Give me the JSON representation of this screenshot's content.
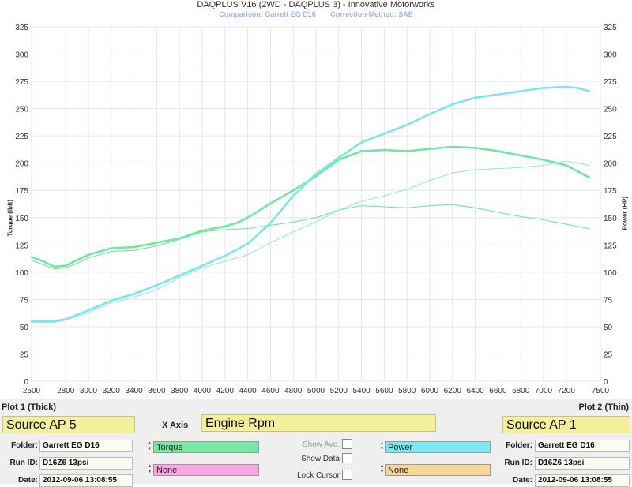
{
  "header": {
    "title": "DAQPLUS V16 (2WD - DAQPLUS 3) - Innovative Motorworks",
    "comparison": "Comparison: Garrett EG D16",
    "correction": "Correction-Method: SAE"
  },
  "chart_data": {
    "type": "line",
    "xlabel": "",
    "ylabel_left": "Torque (lbft)",
    "ylabel_right": "Power (HP)",
    "xlim": [
      2500,
      7500
    ],
    "ylim": [
      0,
      325
    ],
    "x_ticks": [
      2500,
      2800,
      3000,
      3200,
      3400,
      3600,
      3800,
      4000,
      4200,
      4400,
      4600,
      4800,
      5000,
      5200,
      5400,
      5600,
      5800,
      6000,
      6200,
      6400,
      6600,
      6800,
      7000,
      7200,
      7500
    ],
    "y_ticks": [
      0,
      25,
      50,
      75,
      100,
      125,
      150,
      175,
      200,
      225,
      250,
      275,
      300,
      325
    ],
    "grid": true,
    "series": [
      {
        "name": "Torque",
        "plot": "Plot 1 (Thick)",
        "color": "#6ee8a0",
        "width": 2.6,
        "x": [
          2500,
          2600,
          2700,
          2800,
          2900,
          3000,
          3200,
          3400,
          3600,
          3800,
          4000,
          4200,
          4300,
          4400,
          4600,
          4800,
          5000,
          5200,
          5400,
          5600,
          5800,
          6000,
          6200,
          6400,
          6600,
          6800,
          7000,
          7200,
          7400
        ],
        "values": [
          114,
          110,
          105,
          106,
          111,
          116,
          122,
          123,
          127,
          131,
          138,
          142,
          145,
          150,
          163,
          175,
          188,
          203,
          211,
          212,
          211,
          213,
          215,
          214,
          211,
          207,
          203,
          198,
          187
        ]
      },
      {
        "name": "Power",
        "plot": "Plot 1 (Thick)",
        "color": "#7be6ec",
        "width": 2.6,
        "x": [
          2500,
          2700,
          2800,
          3000,
          3200,
          3400,
          3600,
          3800,
          4000,
          4200,
          4400,
          4600,
          4800,
          5000,
          5200,
          5400,
          5600,
          5800,
          6000,
          6200,
          6400,
          6600,
          6800,
          7000,
          7200,
          7300,
          7400
        ],
        "values": [
          55,
          55,
          57,
          65,
          74,
          80,
          88,
          97,
          106,
          115,
          126,
          145,
          170,
          190,
          205,
          219,
          227,
          235,
          245,
          254,
          260,
          263,
          266,
          269,
          270,
          269,
          266
        ]
      },
      {
        "name": "Torque",
        "plot": "Plot 2 (Thin)",
        "color": "#6ee8a0",
        "width": 1.1,
        "x": [
          2500,
          2600,
          2700,
          2800,
          2900,
          3000,
          3200,
          3400,
          3600,
          3800,
          4000,
          4200,
          4400,
          4600,
          4800,
          5000,
          5200,
          5400,
          5600,
          5800,
          6000,
          6200,
          6400,
          6600,
          6800,
          7000,
          7200,
          7400
        ],
        "values": [
          111,
          107,
          103,
          104,
          108,
          113,
          119,
          120,
          124,
          130,
          137,
          139,
          140,
          143,
          146,
          150,
          157,
          161,
          160,
          159,
          161,
          162,
          159,
          155,
          151,
          148,
          144,
          140
        ]
      },
      {
        "name": "Power",
        "plot": "Plot 2 (Thin)",
        "color": "#8ee9ee",
        "width": 1.1,
        "x": [
          2500,
          2700,
          2800,
          3000,
          3200,
          3400,
          3600,
          3800,
          4000,
          4200,
          4400,
          4600,
          4800,
          5000,
          5200,
          5400,
          5600,
          5800,
          6000,
          6200,
          6400,
          6600,
          6800,
          7000,
          7200,
          7400
        ],
        "values": [
          54,
          54,
          56,
          63,
          72,
          77,
          84,
          95,
          104,
          110,
          116,
          127,
          137,
          146,
          157,
          165,
          170,
          176,
          184,
          191,
          194,
          195,
          196,
          198,
          202,
          198
        ]
      }
    ]
  },
  "panel": {
    "plot1_label": "Plot 1 (Thick)",
    "plot2_label": "Plot 2 (Thin)",
    "xaxis_label": "X Axis",
    "xaxis_value": "Engine Rpm",
    "plot1_source": "Source AP 5",
    "plot2_source": "Source AP 1",
    "folder_label": "Folder:",
    "runid_label": "Run ID:",
    "date_label": "Date:",
    "plot1_folder": "Garrett EG D16",
    "plot1_runid": "D16Z6 13psi",
    "plot1_date": "2012-09-06 13:08:55",
    "plot2_folder": "Garrett EG D16",
    "plot2_runid": "D16Z6 13psi",
    "plot2_date": "2012-09-06 13:08:55",
    "channel_torque": "Torque",
    "channel_power": "Power",
    "channel_none_a": "None",
    "channel_none_b": "None",
    "show_ave": "Show Ave.",
    "show_data": "Show Data",
    "lock_cursor": "Lock Cursor",
    "colors": {
      "torque": "#79e8a4",
      "power": "#7ce9f2",
      "none_a": "#f7a6e6",
      "none_b": "#f6d79a",
      "yellow": "#f4ef9a"
    }
  }
}
